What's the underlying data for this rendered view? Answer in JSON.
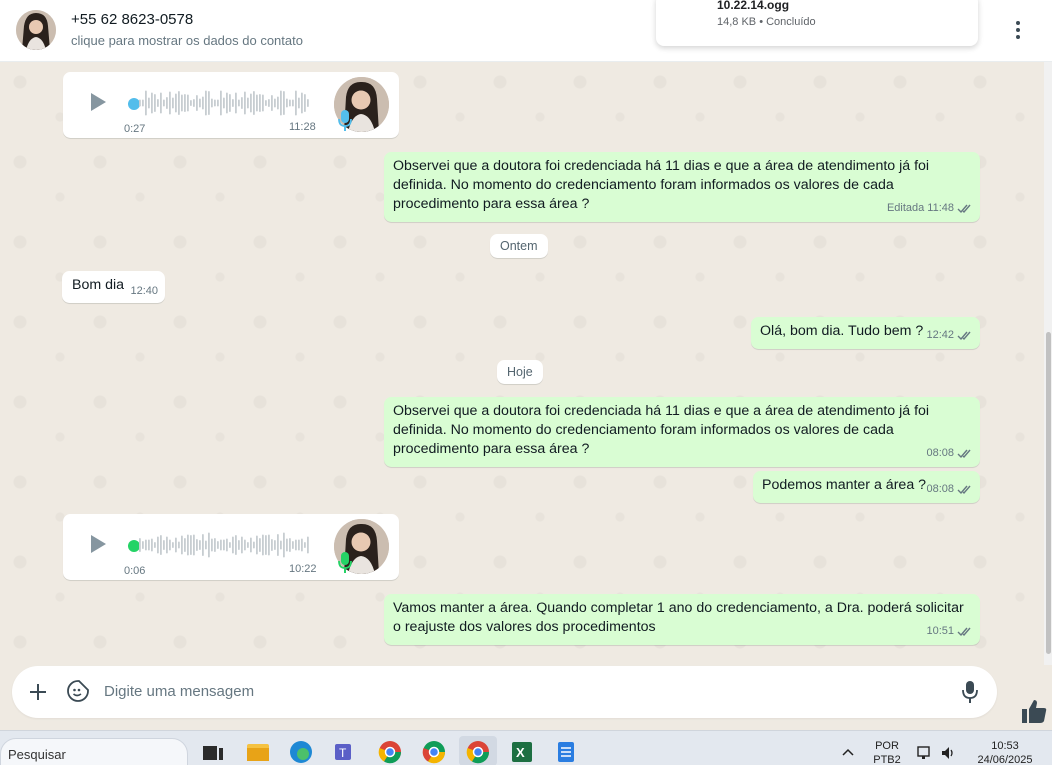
{
  "header": {
    "contact_name": "+55 62 8623-0578",
    "contact_subtitle": "clique para mostrar os dados do contato",
    "menu_icon": "more-vertical-icon"
  },
  "download": {
    "file_name": "10.22.14.ogg",
    "file_meta": "14,8 KB • Concluído"
  },
  "messages": {
    "voice1": {
      "position": "0:27",
      "time": "11:28",
      "progress": 0.0,
      "dot_color": "#53bdeb"
    },
    "out1": {
      "text": "Observei que a doutora foi credenciada há 11 dias e que a área de atendimento já foi definida. No momento do credenciamento foram informados os valores de cada procedimento para essa área ?",
      "edited": "Editada",
      "time": "11:48"
    },
    "date1": "Ontem",
    "in1": {
      "text": "Bom dia",
      "time": "12:40"
    },
    "out2": {
      "text": "Olá, bom dia. Tudo bem ?",
      "time": "12:42"
    },
    "date2": "Hoje",
    "out3": {
      "text": "Observei que a doutora foi credenciada há 11 dias e que a área de atendimento já foi definida. No momento do credenciamento foram informados os valores de cada procedimento para essa área ?",
      "time": "08:08"
    },
    "out4": {
      "text": "Podemos manter a área ?",
      "time": "08:08"
    },
    "voice2": {
      "position": "0:06",
      "time": "10:22",
      "progress": 0.0,
      "dot_color": "#25d366"
    },
    "out5": {
      "text": "Vamos manter a área. Quando completar 1 ano do credenciamento, a Dra. poderá solicitar o reajuste dos valores dos procedimentos",
      "time": "10:51"
    }
  },
  "composer": {
    "placeholder": "Digite uma mensagem"
  },
  "taskbar": {
    "search_label": "Pesquisar",
    "lang_top": "POR",
    "lang_bottom": "PTB2",
    "clock_time": "10:53",
    "clock_date": "24/06/2025"
  },
  "colors": {
    "outgoing_bubble": "#d9fdd3",
    "incoming_bubble": "#ffffff",
    "chat_background": "#efeae2",
    "read_ticks": "#667781"
  }
}
